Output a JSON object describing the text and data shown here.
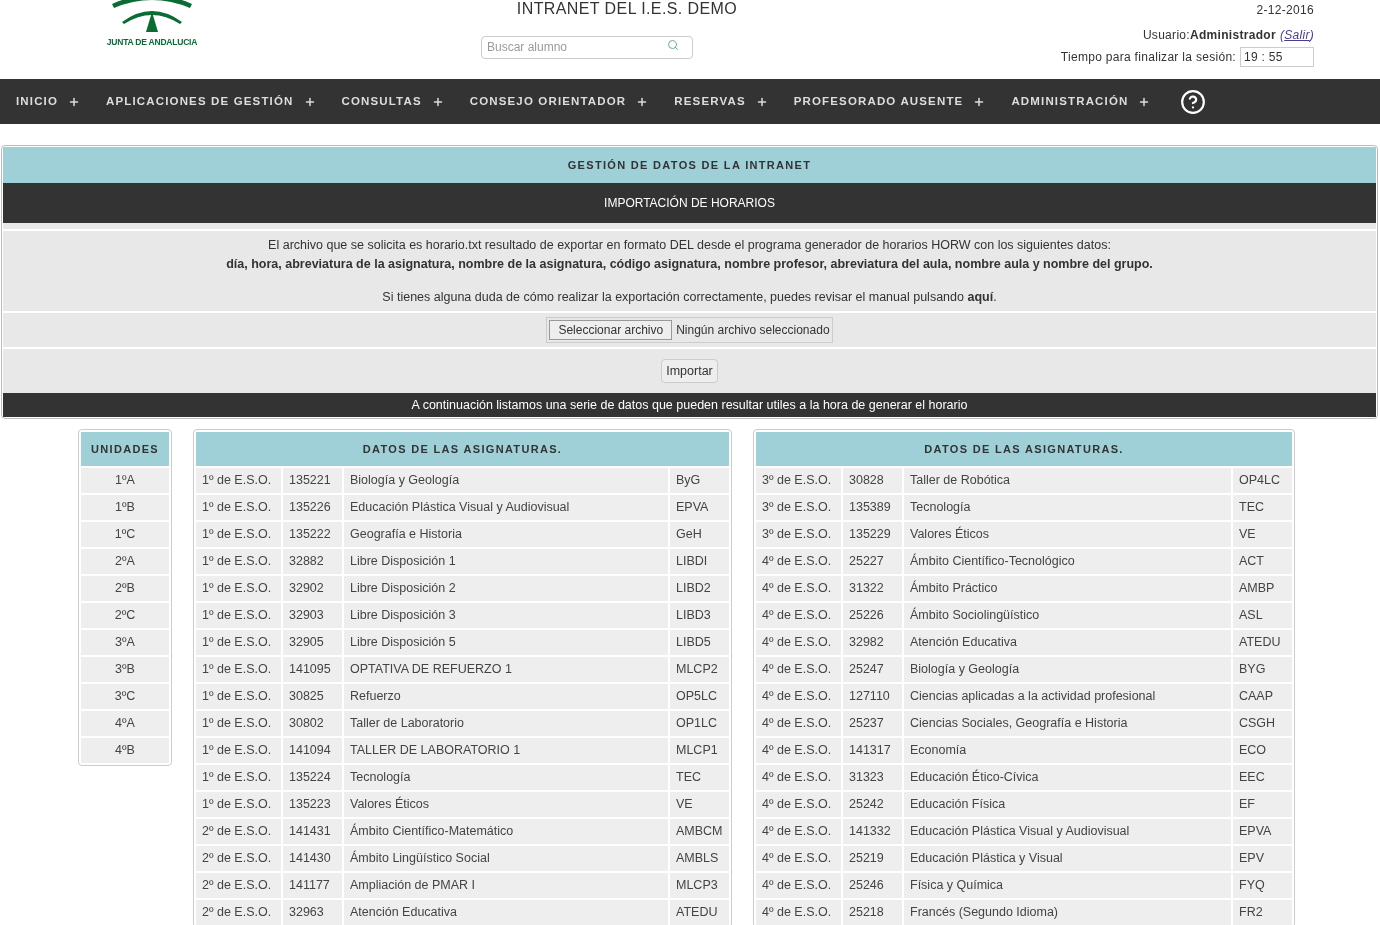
{
  "header": {
    "logo_text": "JUNTA DE ANDALUCIA",
    "title": "INTRANET DEL I.E.S. DEMO",
    "search": {
      "placeholder": "Buscar alumno"
    },
    "date": "2-12-2016",
    "user_label": "Usuario:",
    "user_name": "Administrador",
    "logout_open": "(",
    "logout": "Salir",
    "logout_close": ")",
    "session_label": "Tiempo para finalizar la sesión:",
    "session_time": "19 : 55"
  },
  "nav": [
    {
      "label": "INICIO"
    },
    {
      "label": "APLICACIONES DE GESTIÓN"
    },
    {
      "label": "CONSULTAS"
    },
    {
      "label": "CONSEJO ORIENTADOR"
    },
    {
      "label": "RESERVAS"
    },
    {
      "label": "PROFESORADO AUSENTE"
    },
    {
      "label": "ADMINISTRACIÓN"
    }
  ],
  "panel": {
    "heading": "GESTIÓN DE DATOS DE LA INTRANET",
    "subheading": "IMPORTACIÓN DE HORARIOS",
    "info_line": "El archivo que se solicita es horario.txt resultado de exportar en formato DEL desde el programa generador de horarios HORW con los siguientes datos:",
    "fields_line": "día, hora, abreviatura de la asignatura, nombre de la asignatura, código asignatura, nombre profesor, abreviatura del aula, nombre aula y nombre del grupo.",
    "help_before": "Si tienes alguna duda de cómo realizar la exportación correctamente, puedes revisar el manual pulsando ",
    "help_link": "aquí",
    "help_after": ".",
    "file_button": "Seleccionar archivo",
    "file_status": "Ningún archivo seleccionado",
    "import_button": "Importar",
    "footer": "A continuación listamos una serie de datos que pueden resultar utiles a la hora de generar el horario"
  },
  "units": {
    "heading": "UNIDADES",
    "rows": [
      "1ºA",
      "1ºB",
      "1ºC",
      "2ºA",
      "2ºB",
      "2ºC",
      "3ºA",
      "3ºB",
      "3ºC",
      "4ºA",
      "4ºB"
    ]
  },
  "subjects_left": {
    "heading": "DATOS DE LAS ASIGNATURAS.",
    "rows": [
      [
        "1º de E.S.O.",
        "135221",
        "Biología y Geología",
        "ByG"
      ],
      [
        "1º de E.S.O.",
        "135226",
        "Educación Plástica Visual y Audiovisual",
        "EPVA"
      ],
      [
        "1º de E.S.O.",
        "135222",
        "Geografía e Historia",
        "GeH"
      ],
      [
        "1º de E.S.O.",
        "32882",
        "Libre Disposición 1",
        "LIBDI"
      ],
      [
        "1º de E.S.O.",
        "32902",
        "Libre Disposición 2",
        "LIBD2"
      ],
      [
        "1º de E.S.O.",
        "32903",
        "Libre Disposición 3",
        "LIBD3"
      ],
      [
        "1º de E.S.O.",
        "32905",
        "Libre Disposición 5",
        "LIBD5"
      ],
      [
        "1º de E.S.O.",
        "141095",
        "OPTATIVA DE REFUERZO 1",
        "MLCP2"
      ],
      [
        "1º de E.S.O.",
        "30825",
        "Refuerzo",
        "OP5LC"
      ],
      [
        "1º de E.S.O.",
        "30802",
        "Taller de Laboratorio",
        "OP1LC"
      ],
      [
        "1º de E.S.O.",
        "141094",
        "TALLER DE LABORATORIO 1",
        "MLCP1"
      ],
      [
        "1º de E.S.O.",
        "135224",
        "Tecnología",
        "TEC"
      ],
      [
        "1º de E.S.O.",
        "135223",
        "Valores Éticos",
        "VE"
      ],
      [
        "2º de E.S.O.",
        "141431",
        "Ámbito Científico-Matemático",
        "AMBCM"
      ],
      [
        "2º de E.S.O.",
        "141430",
        "Ámbito Lingüístico Social",
        "AMBLS"
      ],
      [
        "2º de E.S.O.",
        "141177",
        "Ampliación de PMAR I",
        "MLCP3"
      ],
      [
        "2º de E.S.O.",
        "32963",
        "Atención Educativa",
        "ATEDU"
      ]
    ]
  },
  "subjects_right": {
    "heading": "DATOS DE LAS ASIGNATURAS.",
    "rows": [
      [
        "3º de E.S.O.",
        "30828",
        "Taller de Robótica",
        "OP4LC"
      ],
      [
        "3º de E.S.O.",
        "135389",
        "Tecnología",
        "TEC"
      ],
      [
        "3º de E.S.O.",
        "135229",
        "Valores Éticos",
        "VE"
      ],
      [
        "4º de E.S.O.",
        "25227",
        "Ámbito Científico-Tecnológico",
        "ACT"
      ],
      [
        "4º de E.S.O.",
        "31322",
        "Ámbito Práctico",
        "AMBP"
      ],
      [
        "4º de E.S.O.",
        "25226",
        "Ámbito Sociolingüístico",
        "ASL"
      ],
      [
        "4º de E.S.O.",
        "32982",
        "Atención Educativa",
        "ATEDU"
      ],
      [
        "4º de E.S.O.",
        "25247",
        "Biología y Geología",
        "BYG"
      ],
      [
        "4º de E.S.O.",
        "127110",
        "Ciencias aplicadas a la actividad profesional",
        "CAAP"
      ],
      [
        "4º de E.S.O.",
        "25237",
        "Ciencias Sociales, Geografía e Historia",
        "CSGH"
      ],
      [
        "4º de E.S.O.",
        "141317",
        "Economía",
        "ECO"
      ],
      [
        "4º de E.S.O.",
        "31323",
        "Educación Ético-Cívica",
        "EEC"
      ],
      [
        "4º de E.S.O.",
        "25242",
        "Educación Física",
        "EF"
      ],
      [
        "4º de E.S.O.",
        "141332",
        "Educación Plástica Visual y Audiovisual",
        "EPVA"
      ],
      [
        "4º de E.S.O.",
        "25219",
        "Educación Plástica y Visual",
        "EPV"
      ],
      [
        "4º de E.S.O.",
        "25246",
        "Física y Química",
        "FYQ"
      ],
      [
        "4º de E.S.O.",
        "25218",
        "Francés (Segundo Idioma)",
        "FR2"
      ]
    ]
  }
}
